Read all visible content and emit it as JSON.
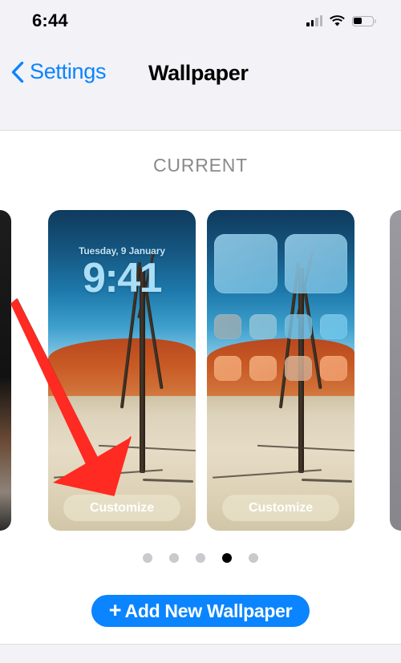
{
  "status_bar": {
    "time": "6:44",
    "cellular_icon": "cellular-bars-icon",
    "wifi_icon": "wifi-icon",
    "battery_icon": "battery-icon",
    "battery_level_percent": 40,
    "signal_bars_filled": 2,
    "signal_bars_total": 4
  },
  "nav_bar": {
    "back_icon": "chevron-left-icon",
    "back_label": "Settings",
    "title": "Wallpaper"
  },
  "content": {
    "section_header": "CURRENT",
    "wallpapers": {
      "lock_screen": {
        "name": "lock-screen-preview",
        "date": "Tuesday, 9 January",
        "time": "9:41",
        "customize_label": "Customize"
      },
      "home_screen": {
        "name": "home-screen-preview",
        "widget_count": 2,
        "app_rows": 2,
        "apps_per_row": 4,
        "customize_label": "Customize"
      }
    },
    "page_dots": {
      "total": 5,
      "active_index": 3
    },
    "add_button": {
      "plus_icon": "plus-icon",
      "label": "Add New Wallpaper"
    }
  },
  "annotation": {
    "arrow_icon": "red-arrow-icon",
    "color": "#FF2A22",
    "points_to": "Customize"
  },
  "colors": {
    "accent_blue": "#0A84FF",
    "chrome_grey": "#F2F2F7",
    "section_header_grey": "#8A8A8E",
    "dot_inactive": "#C9C9CE",
    "dot_active": "#000000",
    "customize_pill": "#E8E0C8"
  }
}
